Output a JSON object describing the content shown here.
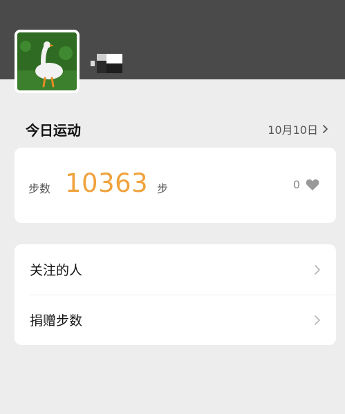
{
  "profile": {
    "avatar_icon": "goose-avatar-icon",
    "username_icon": "redacted-name-icon"
  },
  "today": {
    "title": "今日运动",
    "date": "10月10日"
  },
  "steps_card": {
    "label": "步数",
    "value": "10363",
    "unit": "步",
    "likes": "0",
    "accent_color": "#f0a23c"
  },
  "menu": {
    "items": [
      {
        "label": "关注的人"
      },
      {
        "label": "捐赠步数"
      }
    ]
  }
}
